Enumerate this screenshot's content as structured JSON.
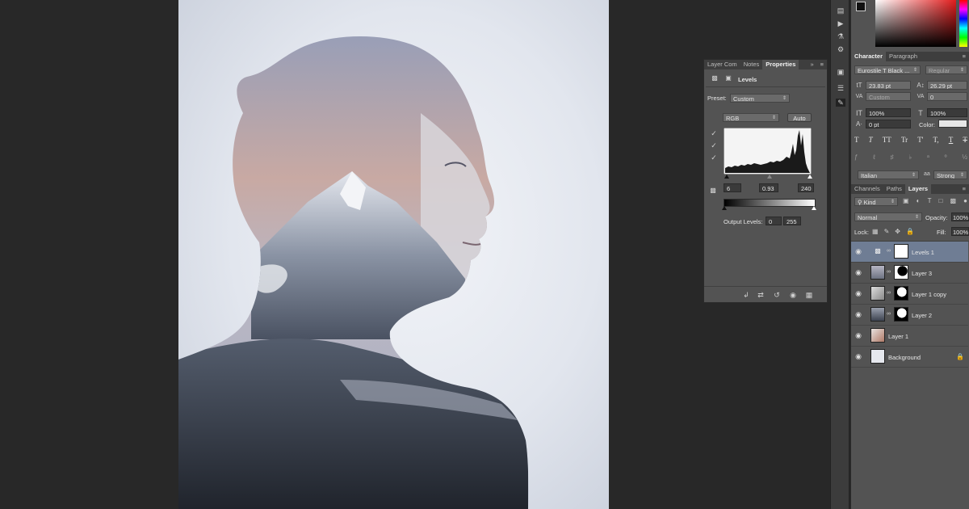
{
  "colors": {
    "app_bg": "#282828",
    "panel_bg": "#535353",
    "selected_layer": "#6f7d94",
    "accent_red": "#d9201e"
  },
  "properties_panel": {
    "tabs": [
      {
        "label": "Layer Com"
      },
      {
        "label": "Notes"
      },
      {
        "label": "Properties"
      }
    ],
    "header_title": "Levels",
    "preset_label": "Preset:",
    "preset_value": "Custom",
    "channel_value": "RGB",
    "auto_button": "Auto",
    "input_black": "6",
    "input_gamma": "0.93",
    "input_white": "240",
    "output_label": "Output Levels:",
    "output_black": "0",
    "output_white": "255"
  },
  "character_panel": {
    "tabs": [
      {
        "label": "Character"
      },
      {
        "label": "Paragraph"
      }
    ],
    "font_family": "Eurostile T Black ...",
    "font_style": "Regular",
    "font_size": "23.83 pt",
    "leading": "26.29 pt",
    "kerning": "Custom",
    "tracking": "0",
    "vertical_scale": "100%",
    "horizontal_scale": "100%",
    "baseline_shift": "0 pt",
    "color_label": "Color:",
    "type_buttons": [
      "T",
      "T",
      "TT",
      "Tr",
      "T'",
      "T,",
      "T",
      "T"
    ],
    "language": "Italian",
    "antialias": "Strong"
  },
  "layers_panel": {
    "tabs": [
      {
        "label": "Channels"
      },
      {
        "label": "Paths"
      },
      {
        "label": "Layers"
      }
    ],
    "filter_kind": "Kind",
    "blend_mode": "Normal",
    "opacity_label": "Opacity:",
    "opacity_value": "100%",
    "lock_label": "Lock:",
    "fill_label": "Fill:",
    "fill_value": "100%",
    "layers": [
      {
        "name": "Levels 1",
        "selected": true,
        "type": "adjustment"
      },
      {
        "name": "Layer 3",
        "selected": false,
        "type": "masked"
      },
      {
        "name": "Layer 1 copy",
        "selected": false,
        "type": "masked"
      },
      {
        "name": "Layer 2",
        "selected": false,
        "type": "masked"
      },
      {
        "name": "Layer 1",
        "selected": false,
        "type": "plain"
      },
      {
        "name": "Background",
        "selected": false,
        "type": "background"
      }
    ]
  }
}
